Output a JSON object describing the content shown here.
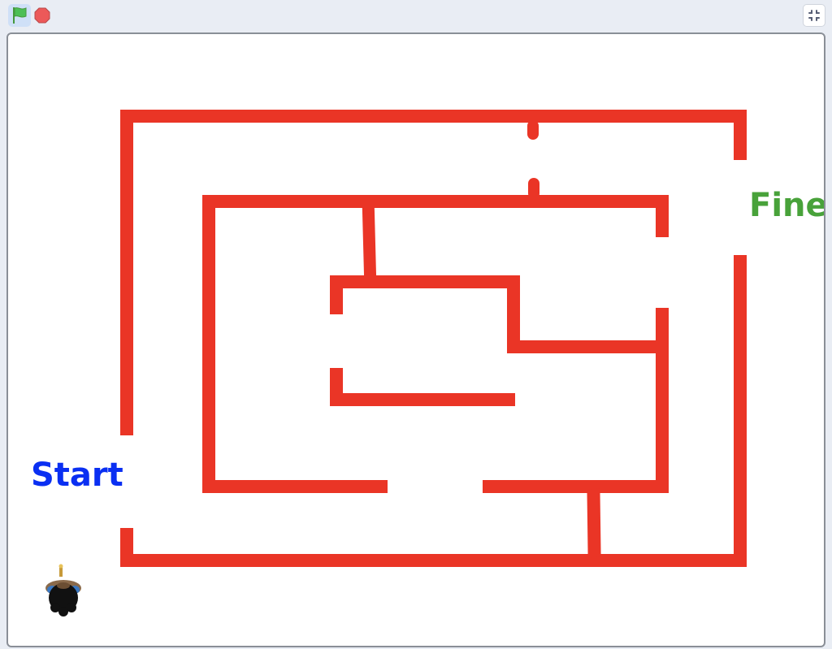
{
  "controls": {
    "green_flag_icon": "green-flag-icon",
    "stop_icon": "stop-sign-icon",
    "fullscreen_icon": "unfullscreen-icon"
  },
  "stage": {
    "start_label": "Start",
    "finish_label": "Fine"
  },
  "colors": {
    "wall": "#ea3526",
    "start_text": "#0a2ff2",
    "finish_text": "#48a23a",
    "flag_green": "#4cbf56",
    "stop_red": "#ec5959",
    "stage_background": "#ffffff"
  },
  "sprite": {
    "icon": "character-sprite-icon",
    "description_only": false
  }
}
